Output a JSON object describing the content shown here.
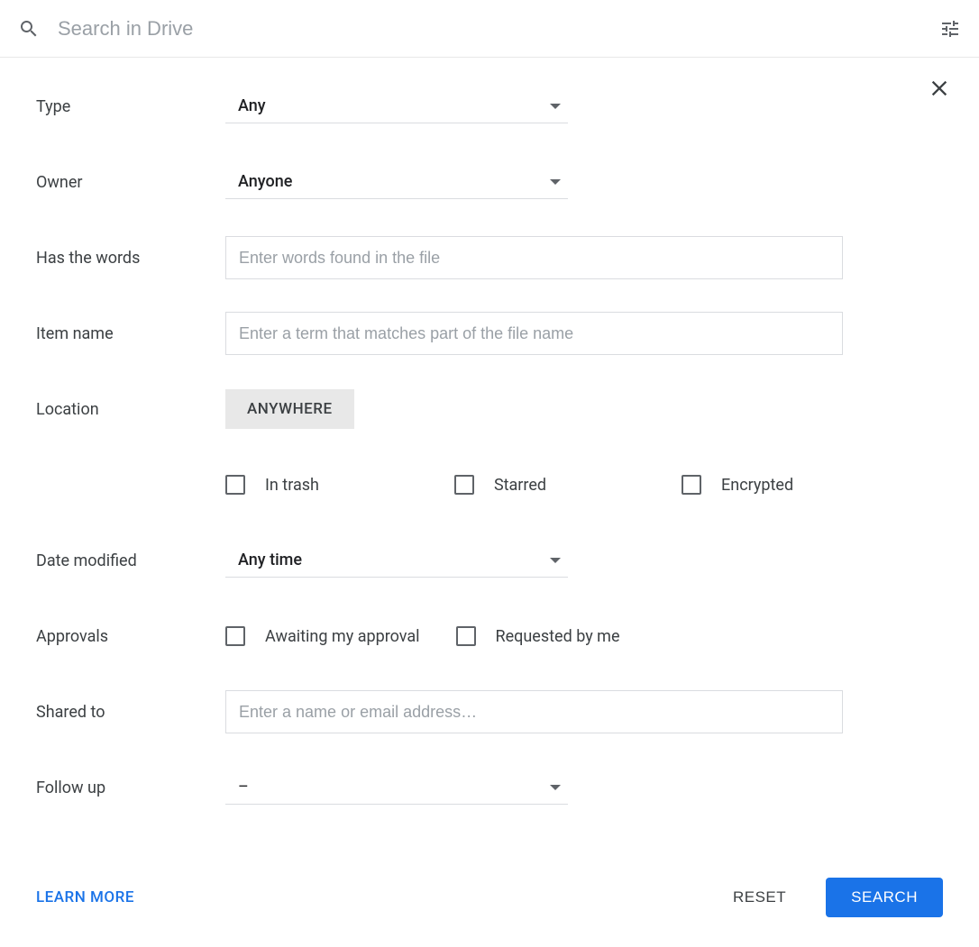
{
  "searchBar": {
    "placeholder": "Search in Drive"
  },
  "form": {
    "type": {
      "label": "Type",
      "value": "Any"
    },
    "owner": {
      "label": "Owner",
      "value": "Anyone"
    },
    "hasWords": {
      "label": "Has the words",
      "placeholder": "Enter words found in the file"
    },
    "itemName": {
      "label": "Item name",
      "placeholder": "Enter a term that matches part of the file name"
    },
    "location": {
      "label": "Location",
      "value": "ANYWHERE"
    },
    "locationChecks": {
      "inTrash": "In trash",
      "starred": "Starred",
      "encrypted": "Encrypted"
    },
    "dateModified": {
      "label": "Date modified",
      "value": "Any time"
    },
    "approvals": {
      "label": "Approvals",
      "awaiting": "Awaiting my approval",
      "requested": "Requested by me"
    },
    "sharedTo": {
      "label": "Shared to",
      "placeholder": "Enter a name or email address…"
    },
    "followUp": {
      "label": "Follow up",
      "value": "–"
    }
  },
  "footer": {
    "learnMore": "LEARN MORE",
    "reset": "RESET",
    "search": "SEARCH"
  }
}
